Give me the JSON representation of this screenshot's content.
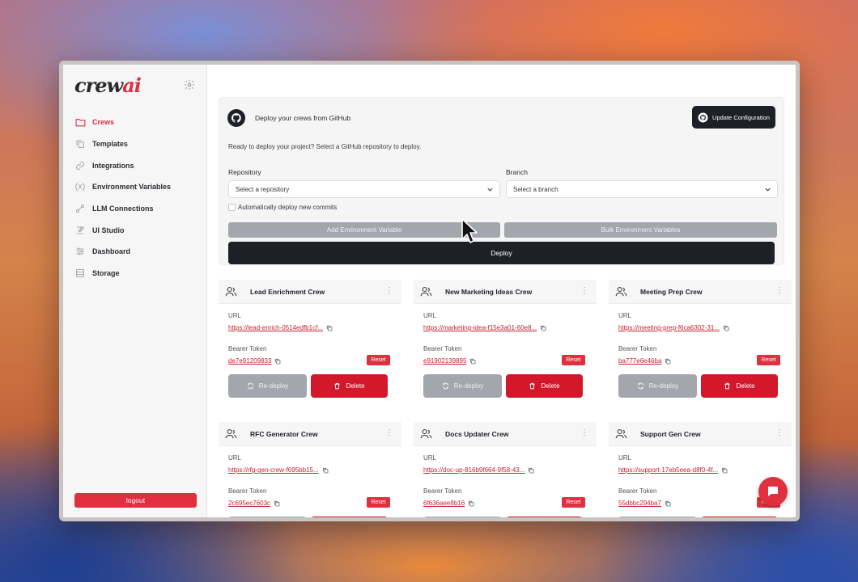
{
  "brand": {
    "logo_text": "crew",
    "logo_accent": "ai",
    "accent_color": "#e0303f",
    "dark_color": "#1d2027"
  },
  "sidebar": {
    "items": [
      {
        "label": "Crews",
        "icon": "folder-icon",
        "active": true
      },
      {
        "label": "Templates",
        "icon": "copy-icon",
        "active": false
      },
      {
        "label": "Integrations",
        "icon": "link-icon",
        "active": false
      },
      {
        "label": "Environment Variables",
        "icon": "variable-icon",
        "active": false
      },
      {
        "label": "LLM Connections",
        "icon": "connection-icon",
        "active": false
      },
      {
        "label": "UI Studio",
        "icon": "pen-square-icon",
        "active": false
      },
      {
        "label": "Dashboard",
        "icon": "sliders-icon",
        "active": false
      },
      {
        "label": "Storage",
        "icon": "storage-icon",
        "active": false
      }
    ],
    "logout_label": "logout"
  },
  "deploy": {
    "title": "Deploy your crews from GitHub",
    "update_button": "Update Configuration",
    "ready_text": "Ready to deploy your project? Select a GitHub repository to deploy.",
    "repository_label": "Repository",
    "repository_placeholder": "Select a repository",
    "branch_label": "Branch",
    "branch_placeholder": "Select a branch",
    "auto_deploy_label": "Automatically deploy new commits",
    "add_env_button": "Add Environment Variable",
    "bulk_env_button": "Bulk Environment Variables",
    "deploy_button": "Deploy"
  },
  "card_labels": {
    "url": "URL",
    "token": "Bearer Token",
    "reset": "Reset",
    "redeploy": "Re-deploy",
    "delete": "Delete"
  },
  "crews": [
    {
      "name": "Lead Enrichment Crew",
      "url": "https://lead-enrich-0514edfb1cf...",
      "token": "de7e91209833"
    },
    {
      "name": "New Marketing Ideas Crew",
      "url": "https://marketing-idea-f15e3a01-60e8...",
      "token": "e91902139895"
    },
    {
      "name": "Meeting Prep Crew",
      "url": "https://meeting-prep-f6ca6302-31...",
      "token": "ba777e6e46ba"
    },
    {
      "name": "RFC Generator Crew",
      "url": "https://rfg-gen-crew-f695bb15...",
      "token": "2c695ec7603c"
    },
    {
      "name": "Docs Updater Crew",
      "url": "https://doc-up-816b9f664-9f58-43...",
      "token": "6f636aee8b16"
    },
    {
      "name": "Support Gen Crew",
      "url": "https://support-17eb5eea-d8f0-4f...",
      "token": "55dbbc294ba7"
    }
  ]
}
